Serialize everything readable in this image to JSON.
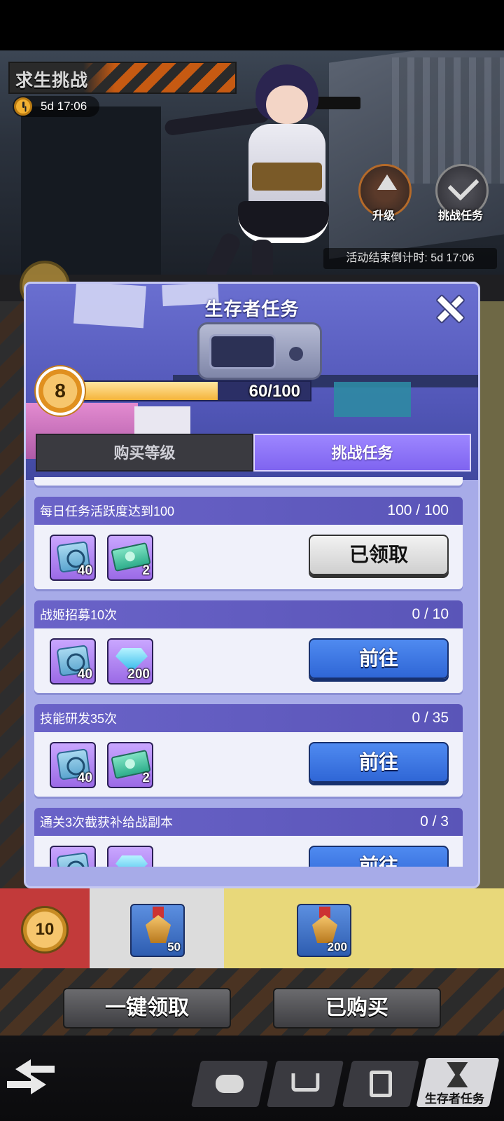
{
  "event": {
    "title": "求生挑战",
    "timer": "5d 17:06"
  },
  "side_buttons": {
    "upgrade_label": "升级",
    "challenge_label": "挑战任务"
  },
  "end_countdown": "活动结束倒计时:  5d 17:06",
  "modal": {
    "title": "生存者任务",
    "level": "8",
    "xp_text": "60/100",
    "xp_fraction": 0.6,
    "tabs": [
      {
        "label": "购买等级",
        "active": false
      },
      {
        "label": "挑战任务",
        "active": true
      }
    ],
    "tasks": [
      {
        "name": "每日任务活跃度达到100",
        "progress": "100 / 100",
        "rewards": [
          {
            "icon": "gear-chest-icon",
            "qty": "40"
          },
          {
            "icon": "ticket-icon",
            "qty": "2"
          }
        ],
        "button": "已领取",
        "state": "claimed"
      },
      {
        "name": "战姬招募10次",
        "progress": "0 / 10",
        "rewards": [
          {
            "icon": "gear-chest-icon",
            "qty": "40"
          },
          {
            "icon": "diamond-icon",
            "qty": "200"
          }
        ],
        "button": "前往",
        "state": "go"
      },
      {
        "name": "技能研发35次",
        "progress": "0 / 35",
        "rewards": [
          {
            "icon": "gear-chest-icon",
            "qty": "40"
          },
          {
            "icon": "ticket-icon",
            "qty": "2"
          }
        ],
        "button": "前往",
        "state": "go"
      },
      {
        "name": "通关3次截获补给战副本",
        "progress": "0 / 3",
        "rewards": [
          {
            "icon": "gear-chest-icon",
            "qty": ""
          },
          {
            "icon": "diamond-icon",
            "qty": ""
          }
        ],
        "button": "前往",
        "state": "go"
      }
    ]
  },
  "bottom_rewards": {
    "level": "10",
    "items": [
      {
        "icon": "medal-icon",
        "qty": "50"
      },
      {
        "icon": "medal-icon",
        "qty": "200"
      }
    ]
  },
  "actions": {
    "claim_all": "一键领取",
    "purchased": "已购买"
  },
  "nav": {
    "items": [
      {
        "icon": "gamepad-icon",
        "label": ""
      },
      {
        "icon": "cart-icon",
        "label": ""
      },
      {
        "icon": "clipboard-icon",
        "label": ""
      },
      {
        "icon": "hourglass-icon",
        "label": "生存者任务",
        "active": true
      }
    ]
  },
  "colors": {
    "accent_purple": "#7f64f0",
    "go_button": "#2f66d6",
    "xp_fill": "#f5b43b",
    "hazard_orange": "#c65a12"
  }
}
